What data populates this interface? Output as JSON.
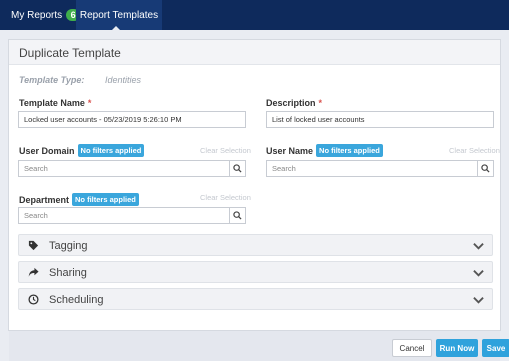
{
  "nav": {
    "tabs": [
      {
        "label": "My Reports",
        "badge": "6"
      },
      {
        "label": "Report Templates"
      }
    ]
  },
  "panel": {
    "title": "Duplicate Template",
    "template_type_label": "Template Type:",
    "template_type_value": "Identities"
  },
  "fields": {
    "template_name": {
      "label": "Template Name",
      "required": "*",
      "value": "Locked user accounts - 05/23/2019 5:26:10 PM"
    },
    "description": {
      "label": "Description",
      "required": "*",
      "value": "List of locked user accounts"
    },
    "user_domain": {
      "label": "User Domain",
      "filter_chip": "No filters applied",
      "clear": "Clear Selection",
      "placeholder": "Search"
    },
    "user_name": {
      "label": "User Name",
      "filter_chip": "No filters applied",
      "clear": "Clear Selection",
      "placeholder": "Search"
    },
    "department": {
      "label": "Department",
      "filter_chip": "No filters applied",
      "clear": "Clear Selection",
      "placeholder": "Search"
    }
  },
  "sections": [
    {
      "label": "Tagging",
      "icon": "tag-icon"
    },
    {
      "label": "Sharing",
      "icon": "share-icon"
    },
    {
      "label": "Scheduling",
      "icon": "clock-icon"
    }
  ],
  "footer": {
    "cancel_label": "Cancel",
    "run_label": "Run Now",
    "save_label": "Save"
  },
  "colors": {
    "nav_bg": "#0e2a5c",
    "badge": "#3fae4c",
    "accent": "#2fa2dc",
    "required": "#d9534f"
  }
}
